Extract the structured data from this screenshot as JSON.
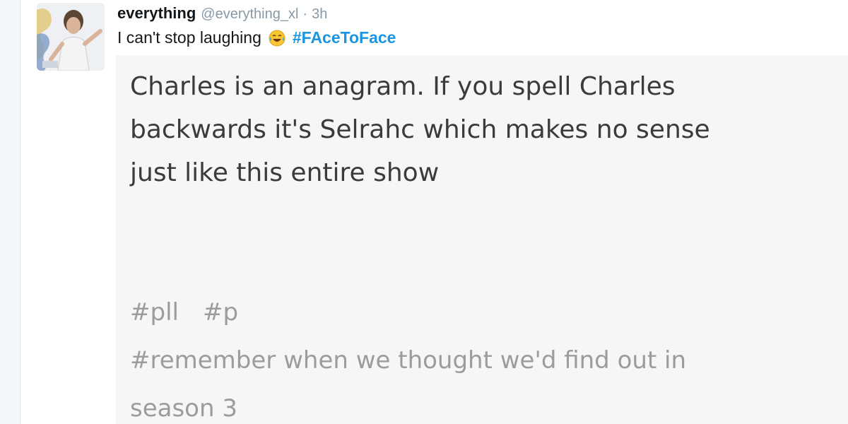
{
  "tweet": {
    "display_name": "everything",
    "handle": "@everything_xl",
    "separator": "·",
    "time": "3h",
    "text": "I can't stop laughing",
    "emoji": "face-with-tears-of-joy-icon",
    "hashtag": "#FAceToFace",
    "hashtag_color": "#1b95e0"
  },
  "media": {
    "lines": [
      "Charles is an anagram. If you spell Charles",
      "backwards it's Selrahc which makes no sense",
      "just like this entire show"
    ],
    "tags": {
      "row1": [
        "#pll",
        "#p"
      ],
      "row2": "#remember when we thought we'd find out in",
      "row3": "season 3"
    }
  }
}
